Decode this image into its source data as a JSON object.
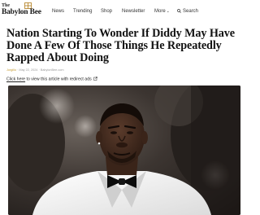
{
  "site": {
    "logo_small": "The",
    "logo_main": "Babylon Bee"
  },
  "nav": {
    "items": [
      "News",
      "Trending",
      "Shop",
      "Newsletter",
      "More"
    ],
    "search_label": "Search"
  },
  "article": {
    "headline": "Nation Starting To Wonder If Diddy May Have Done A Few Of Those Things He Repeatedly Rapped About Doing",
    "author": "Jorgillo",
    "meta": " · May 22, 2024 · BabylonBee.com",
    "redirect_link": "Click here",
    "redirect_rest": " to view this article with redirect ads"
  },
  "icons": {
    "search": "search-icon",
    "external": "external-link-icon",
    "emblem": "bee-emblem-icon",
    "chevron": "chevron-down-icon"
  },
  "colors": {
    "author": "#c49a2e",
    "text": "#111111"
  }
}
